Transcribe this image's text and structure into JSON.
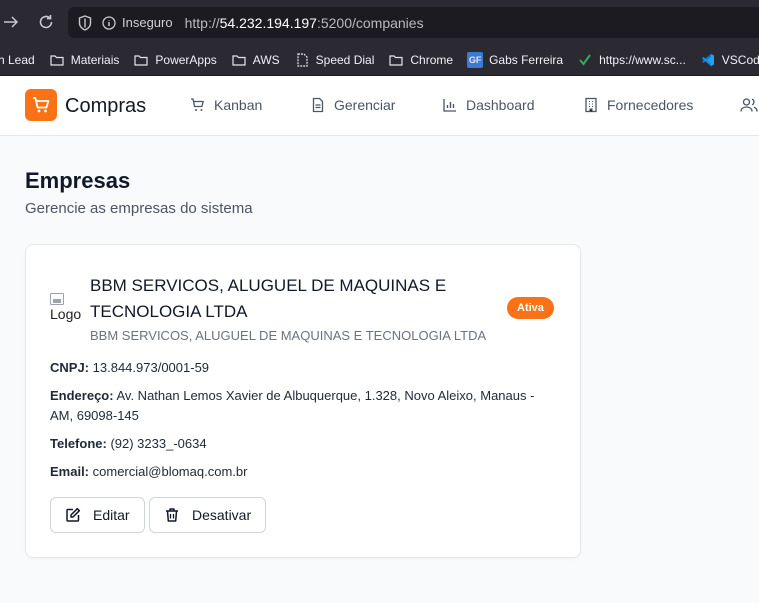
{
  "browser": {
    "insecure_label": "Inseguro",
    "url_scheme": "http://",
    "url_host": "54.232.194.197",
    "url_path": ":5200/companies"
  },
  "bookmarks": [
    {
      "label": "h Lead",
      "icon": "folder-icon"
    },
    {
      "label": "Materiais",
      "icon": "folder-icon"
    },
    {
      "label": "PowerApps",
      "icon": "folder-icon"
    },
    {
      "label": "AWS",
      "icon": "folder-icon"
    },
    {
      "label": "Speed Dial",
      "icon": "page-icon"
    },
    {
      "label": "Chrome",
      "icon": "folder-icon"
    },
    {
      "label": "Gabs Ferreira",
      "icon": "gf-icon",
      "icon_text": "GF"
    },
    {
      "label": "https://www.sc...",
      "icon": "check-icon"
    },
    {
      "label": "VSCode",
      "icon": "vscode-icon"
    }
  ],
  "app": {
    "brand": "Compras",
    "brand_color": "#f97316",
    "nav": [
      {
        "label": "Kanban",
        "icon": "cart-icon"
      },
      {
        "label": "Gerenciar",
        "icon": "document-icon"
      },
      {
        "label": "Dashboard",
        "icon": "bar-chart-icon"
      },
      {
        "label": "Fornecedores",
        "icon": "building-icon"
      }
    ]
  },
  "page": {
    "title": "Empresas",
    "subtitle": "Gerencie as empresas do sistema"
  },
  "company": {
    "logo_alt": "Logo",
    "name": "BBM SERVICOS, ALUGUEL DE MAQUINAS E TECNOLOGIA LTDA",
    "legal_name": "BBM SERVICOS, ALUGUEL DE MAQUINAS E TECNOLOGIA LTDA",
    "status": "Ativa",
    "cnpj_label": "CNPJ:",
    "cnpj": "13.844.973/0001-59",
    "address_label": "Endereço:",
    "address": "Av. Nathan Lemos Xavier de Albuquerque, 1.328, Novo Aleixo, Manaus - AM, 69098-145",
    "phone_label": "Telefone:",
    "phone": "(92) 3233_-0634",
    "email_label": "Email:",
    "email": "comercial@blomaq.com.br",
    "edit_label": "Editar",
    "deactivate_label": "Desativar"
  }
}
